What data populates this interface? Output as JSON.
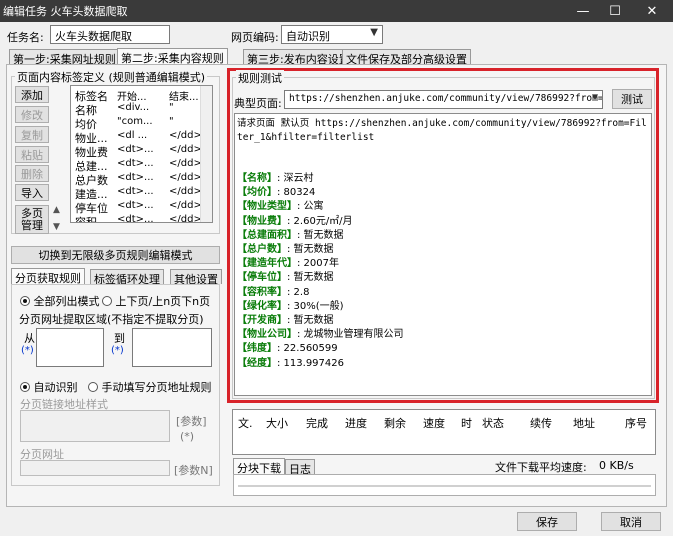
{
  "window": {
    "title": "编辑任务 火车头数据爬取",
    "controls": {
      "minimize": "—",
      "maximize": "☐",
      "close": "✕"
    }
  },
  "task": {
    "label": "任务名:",
    "value": "火车头数据爬取"
  },
  "encoding": {
    "label": "网页编码:",
    "value": "自动识别"
  },
  "main_tabs": [
    "第一步:采集网址规则",
    "第二步:采集内容规则",
    "第三步:发布内容设置",
    "文件保存及部分高级设置"
  ],
  "left": {
    "group_title": "页面内容标签定义 (规则普通编辑模式)",
    "side_buttons": [
      "添加",
      "修改",
      "复制",
      "粘贴",
      "删除",
      "导入"
    ],
    "multi_page_button": "多页\n管理",
    "tag_table": {
      "headers": [
        "标签名",
        "开始...",
        "结束..."
      ],
      "rows": [
        [
          "名称",
          "<div...",
          "\""
        ],
        [
          "均价",
          "\"com...",
          "\""
        ],
        [
          "物业...",
          "<dl ...",
          "</dd>"
        ],
        [
          "物业费",
          "<dt>...",
          "</dd>"
        ],
        [
          "总建...",
          "<dt>...",
          "</dd>"
        ],
        [
          "总户数",
          "<dt>...",
          "</dd>"
        ],
        [
          "建造...",
          "<dt>...",
          "</dd>"
        ],
        [
          "停车位",
          "<dt>...",
          "</dd>"
        ],
        [
          "容积...",
          "<dt>...",
          "</dd>"
        ]
      ]
    },
    "switch_button": "切换到无限级多页规则编辑模式",
    "sub_tabs": [
      "分页获取规则",
      "标签循环处理",
      "其他设置"
    ],
    "paging": {
      "mode_all": "全部列出模式",
      "mode_prevnext": "上下页/上n页下n页",
      "area_title": "分页网址提取区域(不指定不提取分页)",
      "from_label": "从",
      "to_label": "到",
      "auto_detect": "自动识别",
      "manual": "手动填写分页地址规则",
      "link_style_label": "分页链接地址样式",
      "param_button": "[参数]",
      "param_star": "(*)",
      "page_url_label": "分页网址",
      "param_n_button": "[参数N]"
    }
  },
  "rule_test": {
    "title": "规则测试",
    "typical_label": "典型页面:",
    "typical_url": "https://shenzhen.anjuke.com/community/view/786992?from=Filt",
    "test_button": "测试",
    "request_line": "请求页面 默认页 https://shenzhen.anjuke.com/community/view/786992?from=Filter_1&hfilter=filterlist",
    "fields": [
      {
        "k": "【名称】",
        "v": ": 深云村"
      },
      {
        "k": "【均价】",
        "v": ": 80324"
      },
      {
        "k": "【物业类型】",
        "v": ": 公寓"
      },
      {
        "k": "【物业费】",
        "v": ": 2.60元/㎡/月"
      },
      {
        "k": "【总建面积】",
        "v": ": 暂无数据"
      },
      {
        "k": "【总户数】",
        "v": ": 暂无数据"
      },
      {
        "k": "【建造年代】",
        "v": ": 2007年"
      },
      {
        "k": "【停车位】",
        "v": ": 暂无数据"
      },
      {
        "k": "【容积率】",
        "v": ": 2.8"
      },
      {
        "k": "【绿化率】",
        "v": ": 30%(一般)"
      },
      {
        "k": "【开发商】",
        "v": ": 暂无数据"
      },
      {
        "k": "【物业公司】",
        "v": ": 龙城物业管理有限公司"
      },
      {
        "k": "【纬度】",
        "v": ": 22.560599"
      },
      {
        "k": "【经度】",
        "v": ": 113.997426"
      }
    ]
  },
  "download": {
    "columns": [
      "文.",
      "大小",
      "完成",
      "进度",
      "剩余",
      "速度",
      "时",
      "状态",
      "续传",
      "地址",
      "序号"
    ],
    "tabs": [
      "分块下载",
      "日志"
    ],
    "avg_speed_label": "文件下载平均速度:",
    "avg_speed_value": "0 KB/s"
  },
  "footer": {
    "save": "保存",
    "cancel": "取消"
  },
  "colors": {
    "accent_frame": "#d8232a",
    "field_key": "#0a7d0a",
    "titlebar": "#3a3a3a"
  }
}
